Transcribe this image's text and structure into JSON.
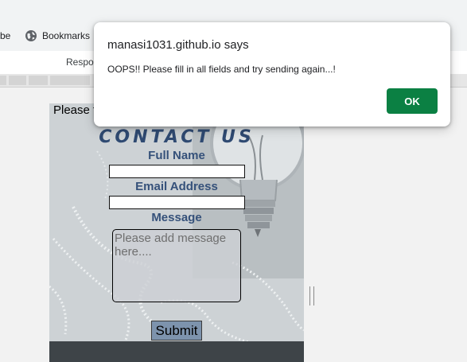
{
  "browser": {
    "bookmarks_partial": "be",
    "bookmarks_label": "Bookmarks",
    "devtools_partial": "Respor"
  },
  "page": {
    "top_message": "Please f",
    "title": "CONTACT US",
    "name_label": "Full Name",
    "email_label": "Email Address",
    "message_label": "Message",
    "name_value": "",
    "email_value": "",
    "message_placeholder": "Please add message here....",
    "submit_label": "Submit"
  },
  "alert": {
    "origin": "manasi1031.github.io says",
    "message": "OOPS!! Please fill in all fields and try sending again...!",
    "ok_label": "OK"
  },
  "colors": {
    "ok_button": "#0b8043",
    "title_text": "#2f4a72",
    "submit_bg": "#7d93ad"
  },
  "icons": {
    "bookmark": "globe-icon"
  }
}
